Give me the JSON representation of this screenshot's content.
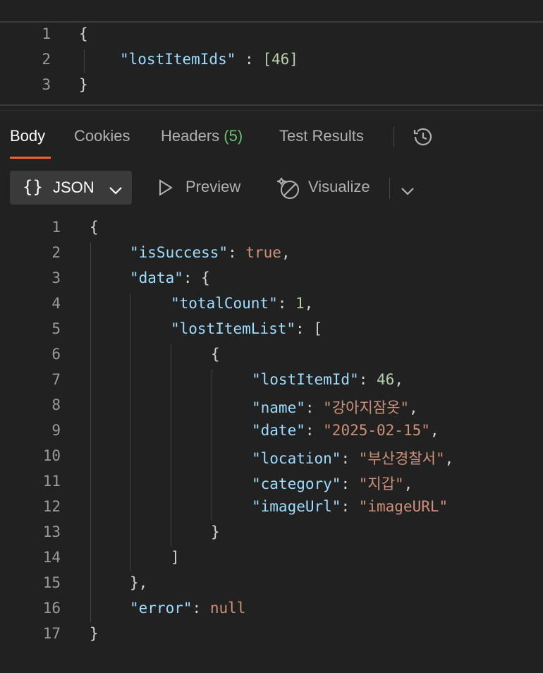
{
  "request_editor": {
    "line_numbers": [
      "1",
      "2",
      "3"
    ],
    "lines": [
      {
        "open": "{"
      },
      {
        "key": "\"lostItemIds\"",
        "sep": " : ",
        "value": "[46]"
      },
      {
        "close": "}"
      }
    ]
  },
  "tabs": {
    "body": "Body",
    "cookies": "Cookies",
    "headers": "Headers",
    "headers_count": "(5)",
    "test_results": "Test Results"
  },
  "toolbar": {
    "format": "JSON",
    "preview": "Preview",
    "visualize": "Visualize"
  },
  "response": {
    "line_numbers": [
      "1",
      "2",
      "3",
      "4",
      "5",
      "6",
      "7",
      "8",
      "9",
      "10",
      "11",
      "12",
      "13",
      "14",
      "15",
      "16",
      "17"
    ],
    "tokens": {
      "l1": "{",
      "l2_key": "\"isSuccess\"",
      "l2_sep": ": ",
      "l2_val": "true",
      "l2_end": ",",
      "l3_key": "\"data\"",
      "l3_sep": ": ",
      "l3_val": "{",
      "l4_key": "\"totalCount\"",
      "l4_sep": ": ",
      "l4_val": "1",
      "l4_end": ",",
      "l5_key": "\"lostItemList\"",
      "l5_sep": ": ",
      "l5_val": "[",
      "l6": "{",
      "l7_key": "\"lostItemId\"",
      "l7_sep": ": ",
      "l7_val": "46",
      "l7_end": ",",
      "l8_key": "\"name\"",
      "l8_sep": ": ",
      "l8_val": "\"강아지잠옷\"",
      "l8_end": ",",
      "l9_key": "\"date\"",
      "l9_sep": ": ",
      "l9_val": "\"2025-02-15\"",
      "l9_end": ",",
      "l10_key": "\"location\"",
      "l10_sep": ": ",
      "l10_val": "\"부산경찰서\"",
      "l10_end": ",",
      "l11_key": "\"category\"",
      "l11_sep": ": ",
      "l11_val": "\"지갑\"",
      "l11_end": ",",
      "l12_key": "\"imageUrl\"",
      "l12_sep": ": ",
      "l12_val": "\"imageURL\"",
      "l13": "}",
      "l14": "]",
      "l15": "},",
      "l16_key": "\"error\"",
      "l16_sep": ": ",
      "l16_val": "null",
      "l17": "}"
    }
  }
}
